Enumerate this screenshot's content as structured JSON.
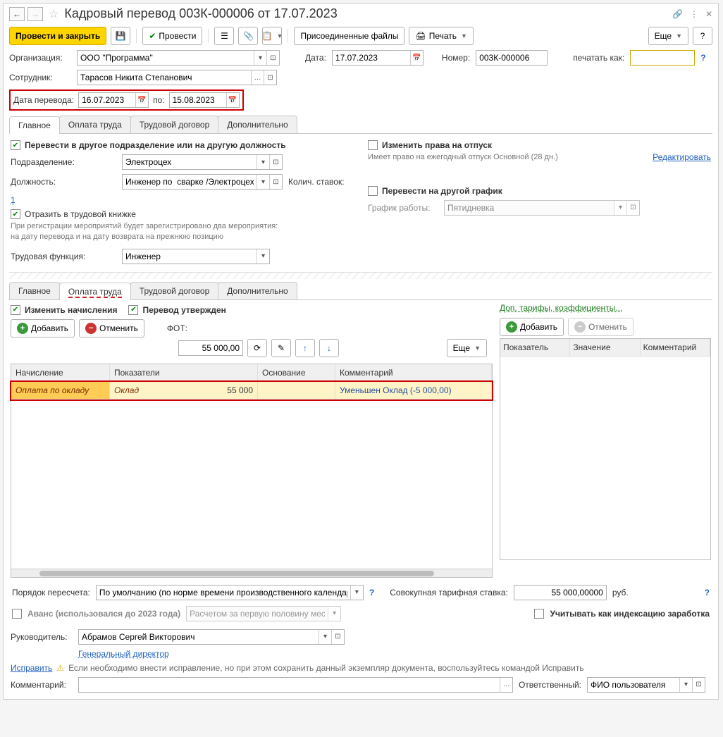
{
  "title": "Кадровый перевод 003К-000006 от 17.07.2023",
  "toolbar": {
    "post_close": "Провести и закрыть",
    "post": "Провести",
    "attached": "Присоединенные файлы",
    "print": "Печать",
    "more": "Еще"
  },
  "fields": {
    "org_label": "Организация:",
    "org_value": "ООО \"Программа\"",
    "date_label": "Дата:",
    "date_value": "17.07.2023",
    "number_label": "Номер:",
    "number_value": "003К-000006",
    "print_as_label": "печатать как:",
    "print_as_value": "",
    "employee_label": "Сотрудник:",
    "employee_value": "Тарасов Никита Степанович",
    "transfer_date_label": "Дата перевода:",
    "transfer_date_from": "16.07.2023",
    "to_label": "по:",
    "transfer_date_to": "15.08.2023"
  },
  "tabs1": [
    "Главное",
    "Оплата труда",
    "Трудовой договор",
    "Дополнительно"
  ],
  "main": {
    "chk_transfer_dept": "Перевести в другое подразделение или на другую должность",
    "dept_label": "Подразделение:",
    "dept_value": "Электроцех",
    "pos_label": "Должность:",
    "pos_value": "Инженер по  сварке /Электроцех",
    "rate_label": "Колич. ставок:",
    "rate_value": "1",
    "chk_workbook": "Отразить в трудовой книжке",
    "workbook_hint": "При регистрации мероприятий будет зарегистрировано два мероприятия: на дату перевода и на дату возврата на прежнюю позицию",
    "func_label": "Трудовая функция:",
    "func_value": "Инженер",
    "chk_vacation": "Изменить права на отпуск",
    "vacation_hint": "Имеет право на ежегодный отпуск Основной (28 дн.)",
    "edit_link": "Редактировать",
    "chk_schedule": "Перевести на другой график",
    "schedule_label": "График работы:",
    "schedule_value": "Пятидневка"
  },
  "tabs2": [
    "Главное",
    "Оплата труда",
    "Трудовой договор",
    "Дополнительно"
  ],
  "pay": {
    "chk_change": "Изменить начисления",
    "chk_approved": "Перевод утвержден",
    "add": "Добавить",
    "cancel": "Отменить",
    "fot_label": "ФОТ:",
    "fot_value": "55 000,00",
    "more": "Еще",
    "table_headers": [
      "Начисление",
      "Показатели",
      "Основание",
      "Комментарий"
    ],
    "row": {
      "accrual": "Оплата по окладу",
      "indicator": "Оклад",
      "indicator_val": "55 000",
      "comment": "Уменьшен Оклад (-5 000,00)"
    },
    "dop_tarif": "Доп. тарифы, коэффициенты...",
    "r_add": "Добавить",
    "r_cancel": "Отменить",
    "r_headers": [
      "Показатель",
      "Значение",
      "Комментарий"
    ],
    "recalc_label": "Порядок пересчета:",
    "recalc_value": "По умолчанию (по норме времени производственного календаря",
    "total_rate_label": "Совокупная тарифная ставка:",
    "total_rate_value": "55 000,00000",
    "rub": "руб.",
    "chk_advance": "Аванс (использовался до 2023 года)",
    "advance_mode": "Расчетом за первую половину мес",
    "chk_index": "Учитывать как индексацию заработка"
  },
  "footer": {
    "manager_label": "Руководитель:",
    "manager_value": "Абрамов Сергей Викторович",
    "manager_pos": "Генеральный директор",
    "fix_link": "Исправить",
    "fix_hint": "Если необходимо внести исправление, но при этом сохранить данный экземпляр документа, воспользуйтесь командой Исправить",
    "comment_label": "Комментарий:",
    "responsible_label": "Ответственный:",
    "responsible_value": "ФИО пользователя"
  }
}
